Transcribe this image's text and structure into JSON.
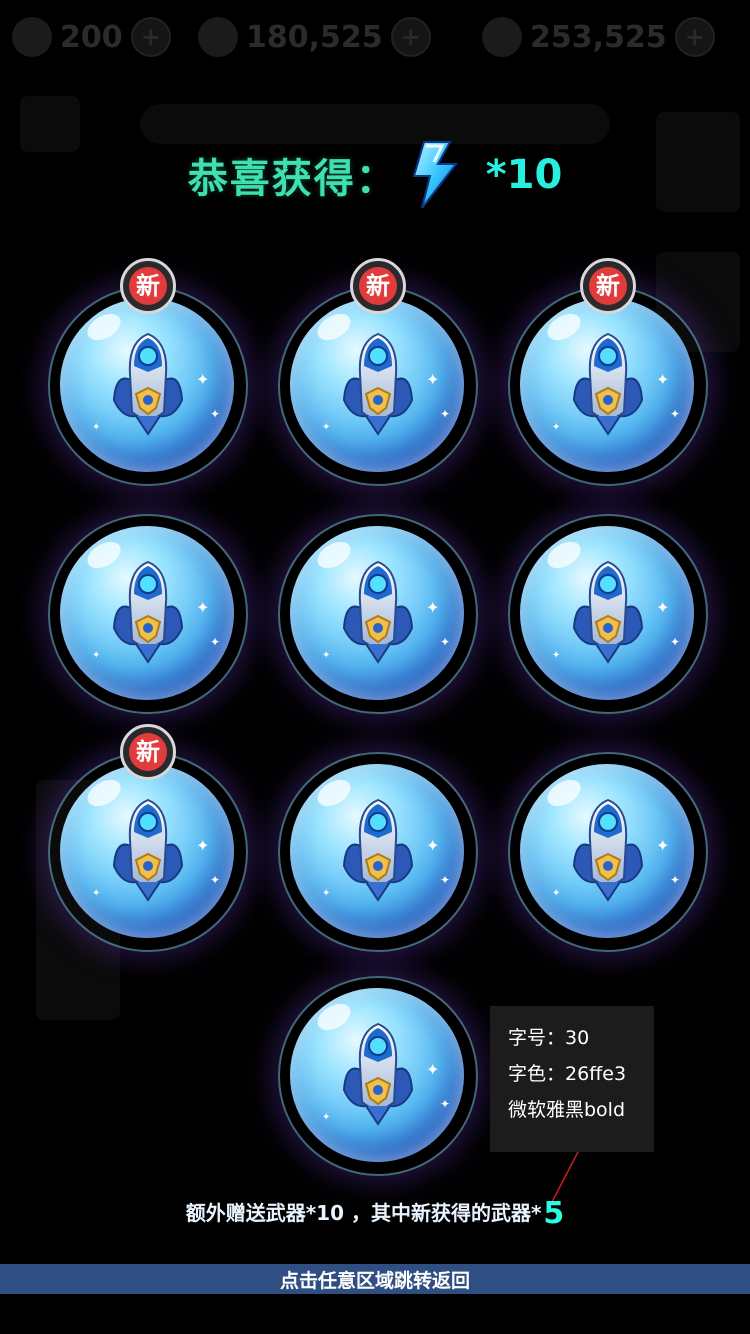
{
  "hud": {
    "energy": "200",
    "coins": "180,525",
    "gems": "253,525",
    "plus_icon": "plus-icon"
  },
  "title": {
    "text": "恭喜获得：",
    "reward_icon": "lightning-bolt-icon",
    "multiplier": "*10"
  },
  "rewards": {
    "badge_label": "新",
    "items": [
      {
        "name": "rocket-weapon",
        "is_new": true
      },
      {
        "name": "rocket-weapon",
        "is_new": true
      },
      {
        "name": "rocket-weapon",
        "is_new": true
      },
      {
        "name": "rocket-weapon",
        "is_new": false
      },
      {
        "name": "rocket-weapon",
        "is_new": false
      },
      {
        "name": "rocket-weapon",
        "is_new": false
      },
      {
        "name": "rocket-weapon",
        "is_new": true
      },
      {
        "name": "rocket-weapon",
        "is_new": false
      },
      {
        "name": "rocket-weapon",
        "is_new": false
      },
      {
        "name": "rocket-weapon",
        "is_new": false
      }
    ]
  },
  "annotation": {
    "font_size": "字号：30",
    "font_color": "字色：26ffe3",
    "font_family": "微软雅黑bold"
  },
  "extra": {
    "text": "额外赠送武器*10 ，其中新获得的武器*",
    "new_count": "5",
    "highlight_color": "#26ffe3"
  },
  "footer": {
    "hint": "点击任意区域跳转返回"
  },
  "colors": {
    "title": "#3fe0b0",
    "badge": "#e23b3b",
    "footer_bar": "#2f4f82"
  }
}
